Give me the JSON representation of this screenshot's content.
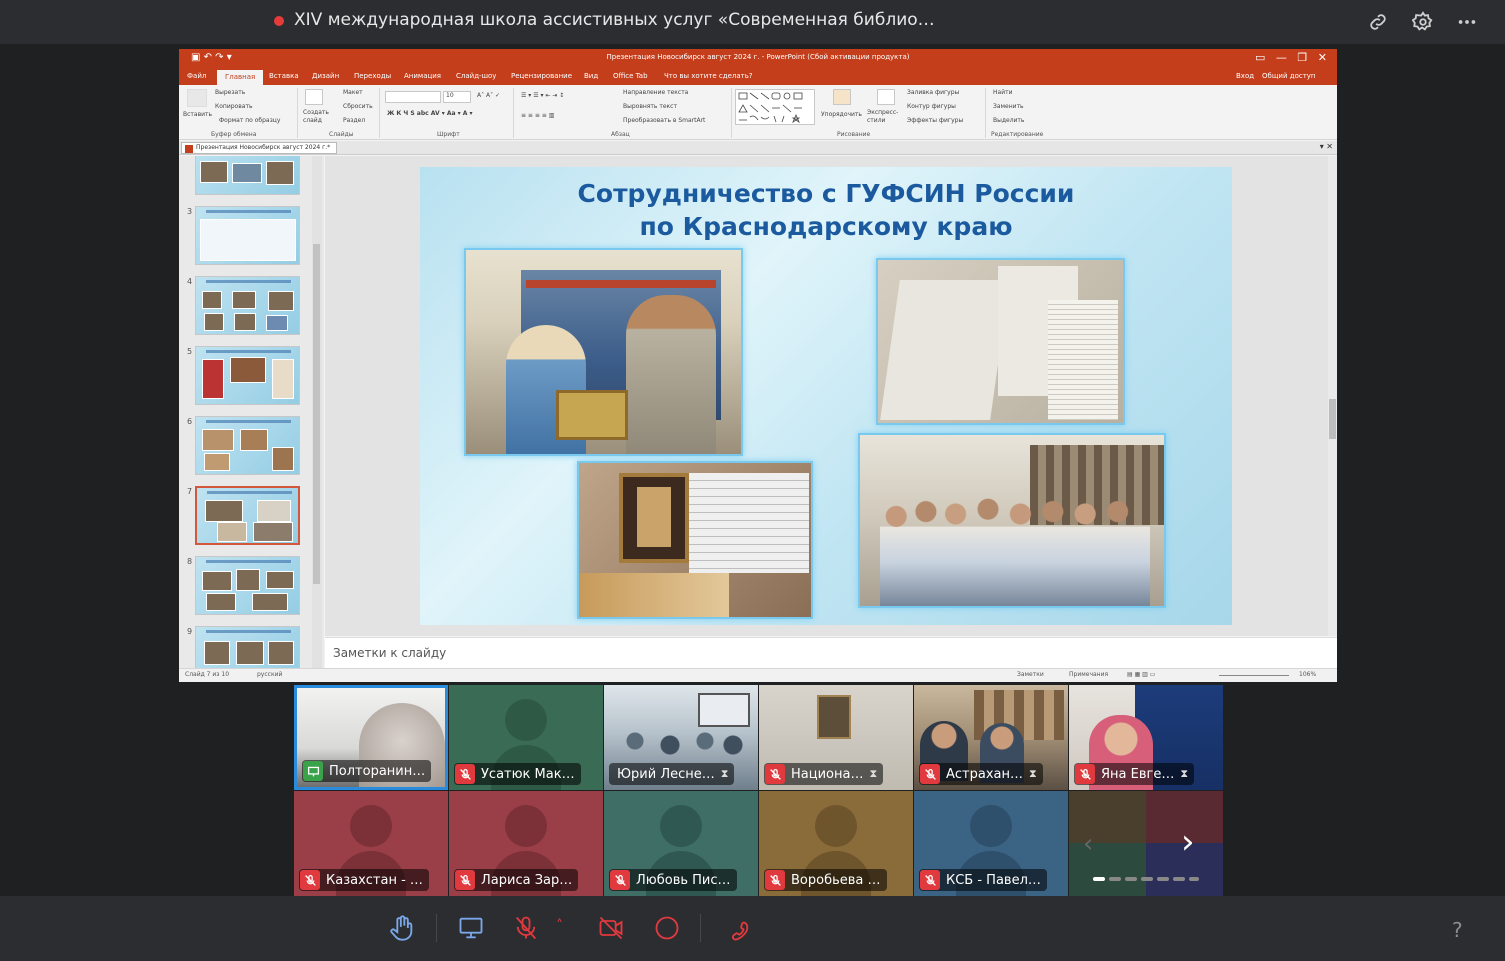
{
  "meeting": {
    "title": "XIV международная школа ассистивных услуг «Современная библио…"
  },
  "ppt": {
    "window_title": "Презентация Новосибирск август 2024 г. - PowerPoint (Сбой активации продукта)",
    "tabs": [
      "Файл",
      "Главная",
      "Вставка",
      "Дизайн",
      "Переходы",
      "Анимация",
      "Слайд-шоу",
      "Рецензирование",
      "Вид",
      "Office Tab",
      "Что вы хотите сделать?"
    ],
    "signin": "Вход",
    "share": "Общий доступ",
    "ribbon": {
      "paste": "Вставить",
      "cut": "Вырезать",
      "copy": "Копировать",
      "format_painter": "Формат по образцу",
      "clipboard": "Буфер обмена",
      "new_slide": "Создать слайд",
      "layout": "Макет",
      "reset": "Сбросить",
      "section": "Раздел",
      "slides": "Слайды",
      "font_size": "10",
      "font": "Шрифт",
      "text_direction": "Направление текста",
      "align_text": "Выровнять текст",
      "smartart": "Преобразовать в SmartArt",
      "paragraph": "Абзац",
      "arrange": "Упорядочить",
      "quick_styles": "Экспресс-стили",
      "shape_fill": "Заливка фигуры",
      "shape_outline": "Контур фигуры",
      "shape_effects": "Эффекты фигуры",
      "drawing": "Рисование",
      "find": "Найти",
      "replace": "Заменить",
      "select": "Выделить",
      "editing": "Редактирование"
    },
    "doc_tab": "Презентация Новосибирск август 2024 г.*",
    "thumbnails": [
      {
        "num": "3"
      },
      {
        "num": "4"
      },
      {
        "num": "5"
      },
      {
        "num": "6"
      },
      {
        "num": "7"
      },
      {
        "num": "8"
      },
      {
        "num": "9"
      }
    ],
    "slide": {
      "title_line1": "Сотрудничество с ГУФСИН России",
      "title_line2": "по Краснодарскому краю"
    },
    "notes_placeholder": "Заметки к слайду",
    "status": {
      "slide_counter": "Слайд 7 из 10",
      "language": "русский",
      "notes": "Заметки",
      "comments": "Примечания",
      "zoom": "106%"
    }
  },
  "participants": [
    {
      "name": "Полторанин…",
      "status": "presenting"
    },
    {
      "name": "Усатюк Мак…",
      "status": "muted"
    },
    {
      "name": "Юрий Лесне…",
      "status": "waiting"
    },
    {
      "name": "Национа…",
      "status": "muted-waiting"
    },
    {
      "name": "Астрахан…",
      "status": "muted-waiting"
    },
    {
      "name": "Яна Евге…",
      "status": "muted-waiting"
    },
    {
      "name": "Казахстан - …",
      "status": "muted"
    },
    {
      "name": "Лариса Зар…",
      "status": "muted"
    },
    {
      "name": "Любовь Пис…",
      "status": "muted"
    },
    {
      "name": "Воробьева …",
      "status": "muted"
    },
    {
      "name": "КСБ - Павел…",
      "status": "muted"
    }
  ],
  "controls": [
    "raise-hand",
    "screen-share",
    "microphone-off",
    "camera-off",
    "record",
    "leave-call"
  ],
  "help": "?"
}
